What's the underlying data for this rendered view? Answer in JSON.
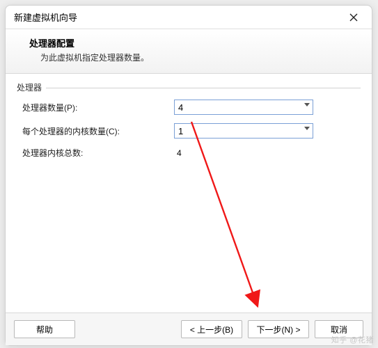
{
  "dialog": {
    "title": "新建虚拟机向导"
  },
  "header": {
    "title": "处理器配置",
    "subtitle": "为此虚拟机指定处理器数量。"
  },
  "group": {
    "label": "处理器",
    "rows": {
      "processors": {
        "label": "处理器数量(P):",
        "value": "4"
      },
      "cores": {
        "label": "每个处理器的内核数量(C):",
        "value": "1"
      },
      "total": {
        "label": "处理器内核总数:",
        "value": "4"
      }
    }
  },
  "footer": {
    "help": "帮助",
    "back": "< 上一步(B)",
    "next": "下一步(N) >",
    "cancel": "取消"
  },
  "watermark": "知乎 @花猪"
}
